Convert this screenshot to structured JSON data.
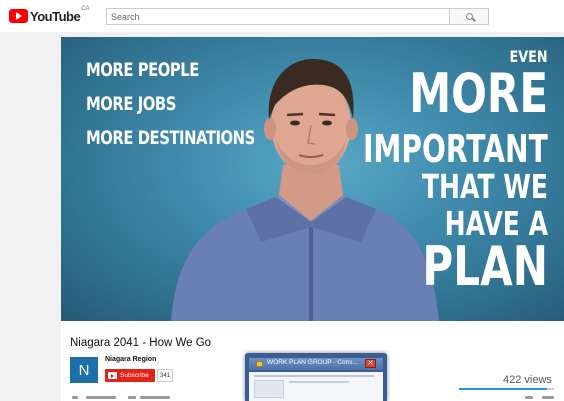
{
  "header": {
    "logo_text": "YouTube",
    "logo_region": "CA",
    "search_placeholder": "Search"
  },
  "video": {
    "left_lines": [
      "MORE PEOPLE",
      "MORE JOBS",
      "MORE DESTINATIONS"
    ],
    "right_lines": [
      "EVEN",
      "MORE",
      "IMPORTANT",
      "THAT WE",
      "HAVE A",
      "PLAN"
    ],
    "background_color": "#3f8aab"
  },
  "info": {
    "title": "Niagara 2041 - How We Go",
    "channel_avatar_letter": "N",
    "channel_name": "Niagara Region",
    "subscribe_label": "Subscribe",
    "subscriber_count": "341",
    "views": "422 views",
    "accent_color": "#e62117"
  },
  "overlay_window": {
    "title": "WORK PLAN GROUP - Cons...",
    "close_glyph": "✕"
  }
}
